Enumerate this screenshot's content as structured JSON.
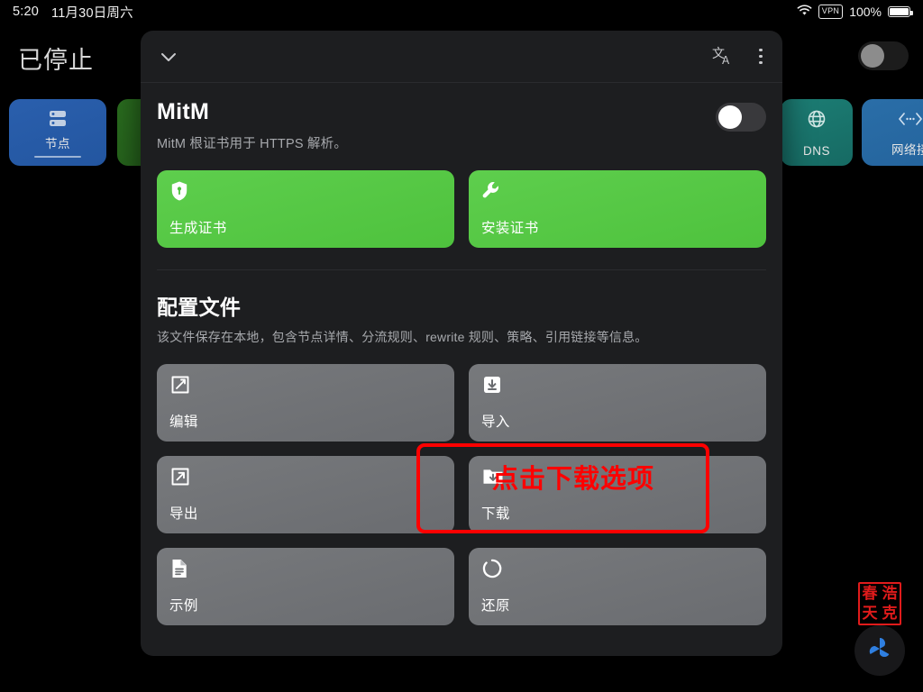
{
  "statusbar": {
    "time": "5:20",
    "date": "11月30日周六",
    "wifi_icon": "wifi-icon",
    "vpn_label": "VPN",
    "battery_percent": "100%",
    "battery_icon": "battery-full-icon"
  },
  "background": {
    "status_title": "已停止",
    "master_toggle": {
      "state": "off"
    },
    "cards": [
      {
        "label": "节点",
        "icon": "server-icon",
        "color": "#2a5fad"
      },
      {
        "label": "",
        "icon": "",
        "color": "#2a6d1f"
      },
      {
        "label": "DNS",
        "icon": "globe-icon",
        "color": "#1c7d74"
      },
      {
        "label": "网络接",
        "icon": "code-brackets-icon",
        "color": "#2a6ea8"
      }
    ],
    "seal": {
      "chars": [
        "春",
        "浩",
        "天",
        "克"
      ],
      "color": "#e01b1b"
    },
    "fab_icon": "propeller-icon"
  },
  "panel": {
    "header": {
      "collapse_icon": "chevron-down-icon",
      "translate_icon": "translate-icon",
      "more_icon": "more-vertical-icon"
    },
    "mitm": {
      "title": "MitM",
      "subtitle": "MitM 根证书用于 HTTPS 解析。",
      "toggle_state": "off",
      "buttons": [
        {
          "label": "生成证书",
          "icon": "shield-key-icon",
          "style": "green"
        },
        {
          "label": "安装证书",
          "icon": "wrench-icon",
          "style": "green"
        }
      ]
    },
    "profile": {
      "title": "配置文件",
      "subtitle": "该文件保存在本地，包含节点详情、分流规则、rewrite 规则、策略、引用链接等信息。",
      "buttons": [
        {
          "label": "编辑",
          "icon": "edit-square-icon",
          "style": "grey"
        },
        {
          "label": "导入",
          "icon": "import-box-icon",
          "style": "grey"
        },
        {
          "label": "导出",
          "icon": "export-arrow-icon",
          "style": "grey"
        },
        {
          "label": "下载",
          "icon": "download-folder-icon",
          "style": "grey"
        },
        {
          "label": "示例",
          "icon": "document-icon",
          "style": "grey"
        },
        {
          "label": "还原",
          "icon": "restore-circle-icon",
          "style": "grey"
        }
      ]
    }
  },
  "annotation": {
    "text": "点击下载选项",
    "color": "#fe0000",
    "target_label": "下载"
  }
}
